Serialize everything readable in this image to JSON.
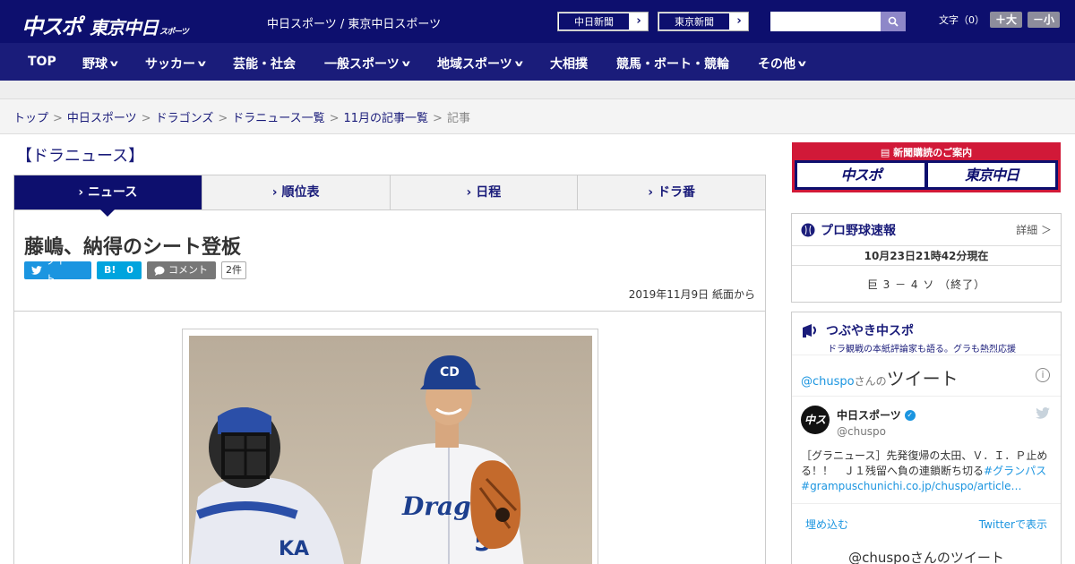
{
  "header": {
    "logo_main": "中スポ",
    "logo_sub": "東京中日",
    "logo_sub_small": "スポーツ",
    "site_links": "中日スポーツ / 東京中日スポーツ",
    "paper1": "中日新聞",
    "paper2": "東京新聞",
    "fontsize_label": "文字（0）",
    "font_large": "＋大",
    "font_small": "－小"
  },
  "nav": [
    {
      "label": "TOP",
      "chev": false
    },
    {
      "label": "野球",
      "chev": true
    },
    {
      "label": "サッカー",
      "chev": true
    },
    {
      "label": "芸能・社会",
      "chev": false
    },
    {
      "label": "一般スポーツ",
      "chev": true
    },
    {
      "label": "地域スポーツ",
      "chev": true
    },
    {
      "label": "大相撲",
      "chev": false
    },
    {
      "label": "競馬・ボート・競輪",
      "chev": false
    },
    {
      "label": "その他",
      "chev": true
    }
  ],
  "breadcrumb": {
    "items": [
      "トップ",
      "中日スポーツ",
      "ドラゴンズ",
      "ドラニュース一覧",
      "11月の記事一覧"
    ],
    "current": "記事"
  },
  "section_title": "【ドラニュース】",
  "tabs": [
    "ニュース",
    "順位表",
    "日程",
    "ドラ番"
  ],
  "article": {
    "headline": "藤嶋、納得のシート登板",
    "tweet_label": "ツイート",
    "hatena_label": "B!",
    "hatena_count": "0",
    "comment_label": "コメント",
    "comment_count": "2件",
    "dateline": "2019年11月9日 紙面から"
  },
  "sidebar": {
    "subscribe_title": "新聞購読のご案内",
    "subscribe_logo1": "中スポ",
    "subscribe_logo2": "東京中日",
    "baseball_title": "プロ野球速報",
    "baseball_more": "詳細 ＞",
    "score_date": "10月23日21時42分現在",
    "score_line": "巨 3 － 4 ソ （終了）",
    "tsubuyaki_title": "つぶやき中スポ",
    "tsubuyaki_sub": "ドラ観戦の本紙評論家も語る。グラも熱烈応援",
    "tw_handle_prefix": "@chuspo",
    "tw_handle_mid": "さんの",
    "tw_title_big": "ツイート",
    "tw_avatar": "中スポ",
    "tw_name": "中日スポーツ",
    "tw_handle": "@chuspo",
    "tw_text": "［グラニュース］先発復帰の太田、Ｖ．Ｉ．Ｐ止める！！　Ｊ１残留へ負の連鎖断ち切る",
    "tw_tag1": "#グランパス",
    "tw_tag2": "#",
    "tw_link": "grampuschunichi.co.jp/chuspo/article…",
    "tw_embed": "埋め込む",
    "tw_view": "Twitterで表示",
    "tw_footer": "@chuspoさんのツイート"
  },
  "colors": {
    "brand_navy": "#0d0f6e",
    "nav_navy": "#1a1c7a",
    "subscribe_red": "#d11938",
    "twitter_blue": "#1b95e0"
  }
}
